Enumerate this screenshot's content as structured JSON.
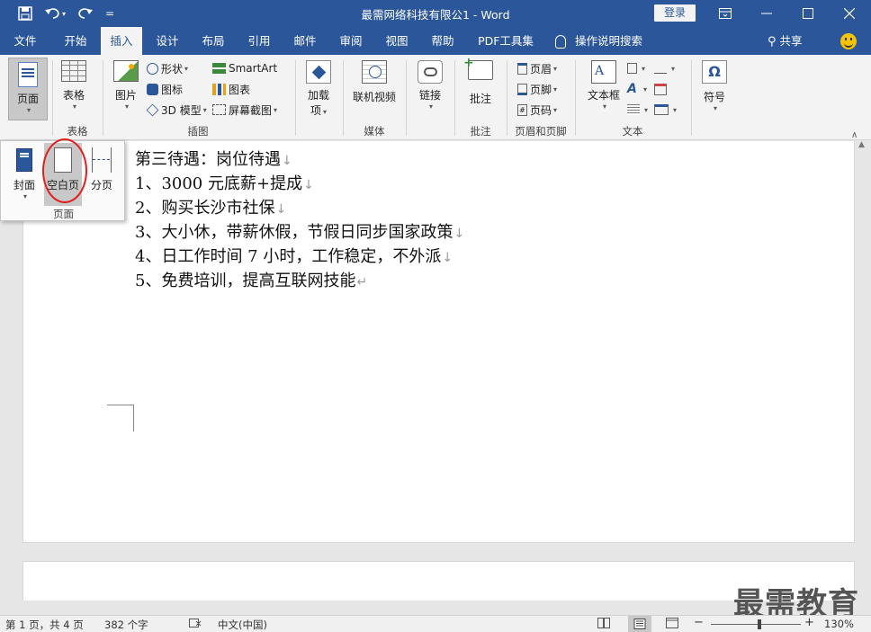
{
  "titlebar": {
    "title": "最需网络科技有限公1 - Word",
    "login": "登录",
    "qat_customize": "="
  },
  "tabs": [
    {
      "label": "文件"
    },
    {
      "label": "开始"
    },
    {
      "label": "插入"
    },
    {
      "label": "设计"
    },
    {
      "label": "布局"
    },
    {
      "label": "引用"
    },
    {
      "label": "邮件"
    },
    {
      "label": "审阅"
    },
    {
      "label": "视图"
    },
    {
      "label": "帮助"
    },
    {
      "label": "PDF工具集"
    }
  ],
  "tell_me": "操作说明搜索",
  "share": "共享",
  "ribbon": {
    "pages": {
      "button": "页面",
      "label": ""
    },
    "table": {
      "button": "表格",
      "label": "表格"
    },
    "illustrations": {
      "picture": "图片",
      "shapes": "形状",
      "icons": "图标",
      "model3d": "3D 模型",
      "smartart": "SmartArt",
      "chart": "图表",
      "screenshot": "屏幕截图",
      "label": "插图"
    },
    "addins": {
      "button_l1": "加载",
      "button_l2": "项"
    },
    "media": {
      "button": "联机视频",
      "label": "媒体"
    },
    "links": {
      "button": "链接"
    },
    "comments": {
      "button": "批注",
      "label": "批注"
    },
    "header_footer": {
      "header": "页眉",
      "footer": "页脚",
      "page_number": "页码",
      "label": "页眉和页脚"
    },
    "text": {
      "textbox": "文本框",
      "label": "文本"
    },
    "symbols": {
      "button": "符号"
    }
  },
  "dropdown": {
    "cover": "封面",
    "blank": "空白页",
    "break": "分页",
    "label": "页面"
  },
  "document": {
    "lines": [
      "第三待遇：岗位待遇",
      "1、3000 元底薪+提成",
      "2、购买长沙市社保",
      "3、大小休，带薪休假，节假日同步国家政策",
      "4、日工作时间 7 小时，工作稳定，不外派",
      "5、免费培训，提高互联网技能"
    ],
    "line_mark": "↓",
    "para_mark": "↵"
  },
  "watermark": "最需教育",
  "status": {
    "page": "第 1 页，共 4 页",
    "words": "382 个字",
    "language": "中文(中国)",
    "zoom": "130%",
    "zoom_minus": "−",
    "zoom_plus": "+"
  }
}
